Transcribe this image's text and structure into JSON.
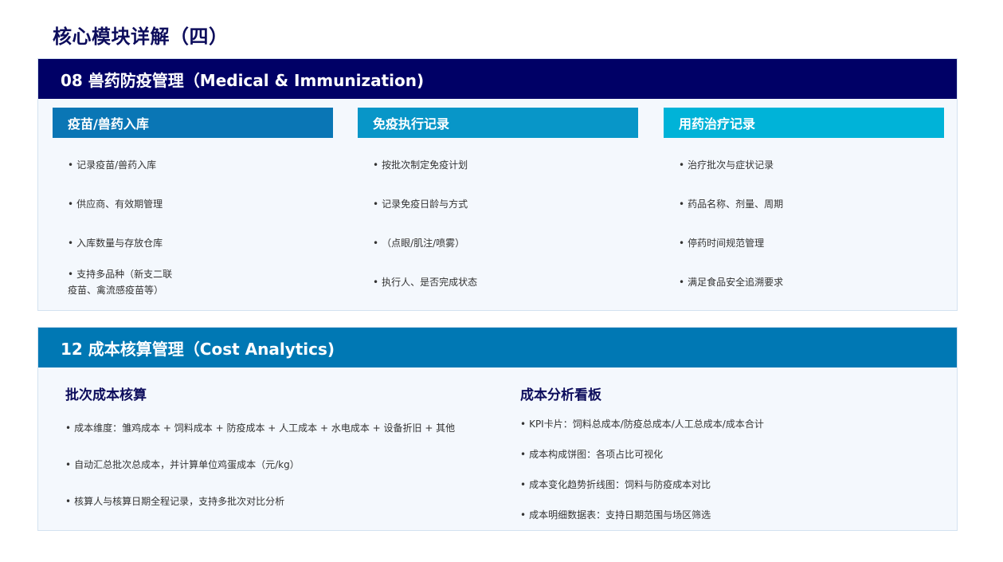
{
  "page": {
    "title": "核心模块详解（四）"
  },
  "medical": {
    "header": "08  兽药防疫管理（Medical & Immunization)",
    "columns": [
      {
        "title": "疫苗/兽药入库",
        "items": [
          "记录疫苗/兽药入库",
          "供应商、有效期管理",
          "入库数量与存放仓库",
          "支持多品种（新支二联疫苗、禽流感疫苗等）"
        ]
      },
      {
        "title": "免疫执行记录",
        "items": [
          "按批次制定免疫计划",
          "记录免疫日龄与方式",
          "（点眼/肌注/喷雾）",
          "执行人、是否完成状态"
        ]
      },
      {
        "title": "用药治疗记录",
        "items": [
          "治疗批次与症状记录",
          "药品名称、剂量、周期",
          "停药时间规范管理",
          "满足食品安全追溯要求"
        ]
      }
    ]
  },
  "cost": {
    "header": "12  成本核算管理（Cost Analytics)",
    "left": {
      "title": "批次成本核算",
      "items": [
        "成本维度：雏鸡成本 + 饲料成本 + 防疫成本 + 人工成本 + 水电成本 + 设备折旧 + 其他",
        "自动汇总批次总成本，并计算单位鸡蛋成本（元/kg）",
        "核算人与核算日期全程记录，支持多批次对比分析"
      ]
    },
    "right": {
      "title": "成本分析看板",
      "items": [
        "KPI卡片：饲料总成本/防疫总成本/人工总成本/成本合计",
        "成本构成饼图：各项占比可视化",
        "成本变化趋势折线图：饲料与防疫成本对比",
        "成本明细数据表：支持日期范围与场区筛选"
      ]
    }
  }
}
